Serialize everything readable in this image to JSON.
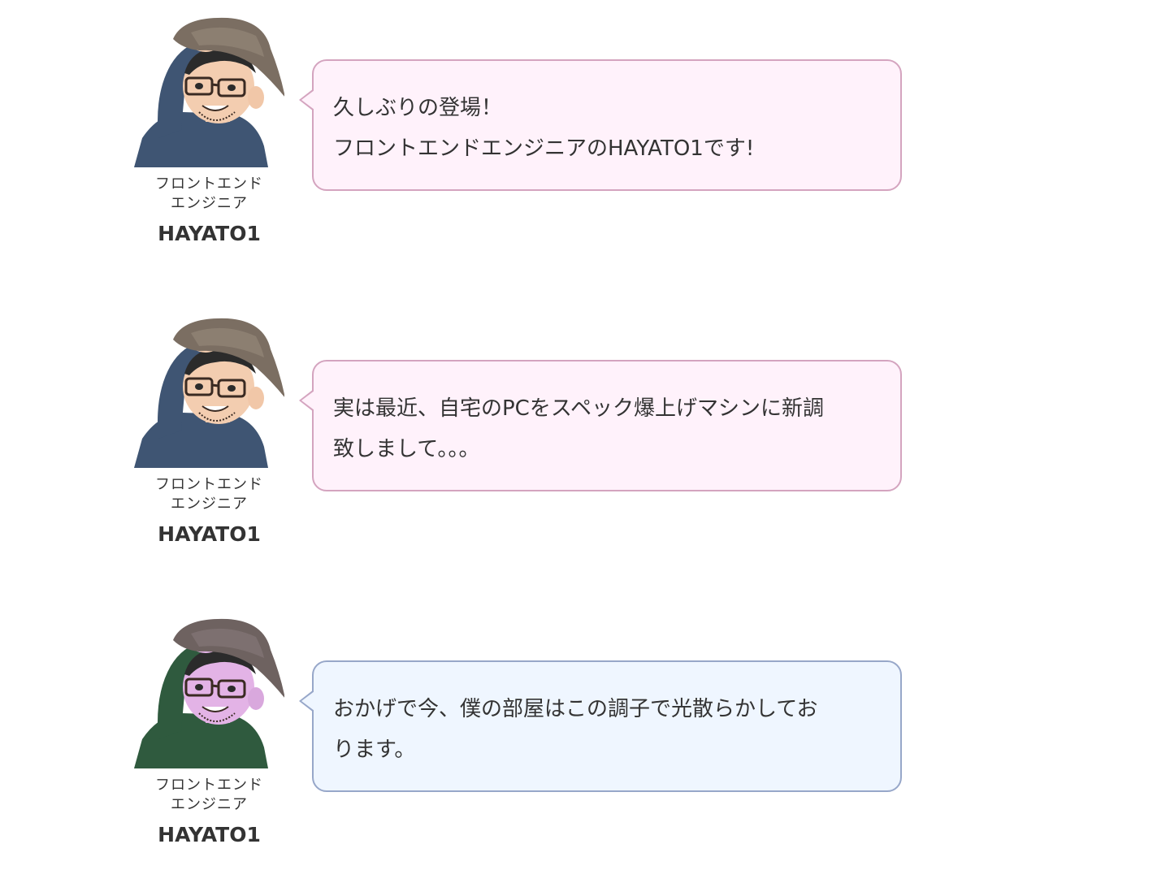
{
  "messages": [
    {
      "speaker": {
        "role_lines": [
          "フロントエンド",
          "エンジニア"
        ],
        "name": "HAYATO1",
        "avatar_icon": "hayato1-avatar-icon"
      },
      "lines": [
        "久しぶりの登場！",
        "フロントエンドエンジニアのHAYATO1です!"
      ],
      "style": "pink"
    },
    {
      "speaker": {
        "role_lines": [
          "フロントエンド",
          "エンジニア"
        ],
        "name": "HAYATO1",
        "avatar_icon": "hayato1-avatar-icon"
      },
      "lines": [
        "実は最近、自宅のPCをスペック爆上げマシンに新調",
        "致しまして。。。"
      ],
      "style": "pink"
    },
    {
      "speaker": {
        "role_lines": [
          "フロントエンド",
          "エンジニア"
        ],
        "name": "HAYATO1",
        "avatar_icon": "hayato1-gaming-avatar-icon"
      },
      "lines": [
        "おかげで今、僕の部屋はこの調子で光散らかしてお",
        "ります。"
      ],
      "style": "blue"
    }
  ],
  "colors": {
    "pink_bubble_bg": "#fff2fb",
    "pink_bubble_border": "#d4a4bf",
    "blue_bubble_bg": "#eff6ff",
    "blue_bubble_border": "#97a7c9",
    "text": "#333333"
  }
}
